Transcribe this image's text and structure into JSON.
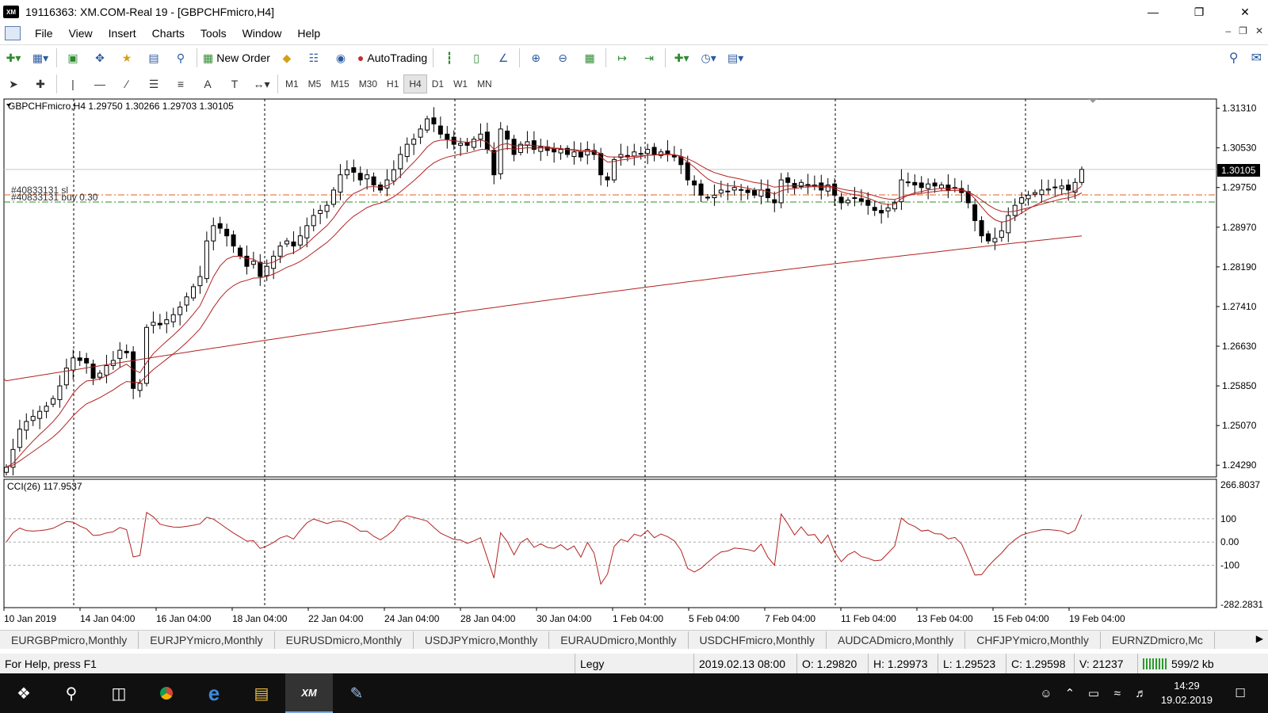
{
  "window": {
    "title": "19116363: XM.COM-Real 19 - [GBPCHFmicro,H4]",
    "logo": "XM"
  },
  "menu": [
    "File",
    "View",
    "Insert",
    "Charts",
    "Tools",
    "Window",
    "Help"
  ],
  "toolbar": {
    "new_order": "New Order",
    "auto_trading": "AutoTrading"
  },
  "timeframes": [
    "M1",
    "M5",
    "M15",
    "M30",
    "H1",
    "H4",
    "D1",
    "W1",
    "MN"
  ],
  "active_timeframe": "H4",
  "chart": {
    "header": "GBPCHFmicro,H4  1.29750 1.30266 1.29703 1.30105",
    "order_sl_label": "#40833131 sl",
    "order_buy_label": "#40833131 buy 0.30",
    "current_price": "1.30105",
    "price_ticks": [
      "1.31310",
      "1.30530",
      "1.29750",
      "1.28970",
      "1.28190",
      "1.27410",
      "1.26630",
      "1.25850",
      "1.25070",
      "1.24290"
    ],
    "indicator_label": "CCI(26) 117.9537",
    "cci_ticks": [
      "266.8037",
      "100",
      "0.00",
      "-100",
      "-282.2831"
    ],
    "time_ticks": [
      "10 Jan 2019",
      "14 Jan 04:00",
      "16 Jan 04:00",
      "18 Jan 04:00",
      "22 Jan 04:00",
      "24 Jan 04:00",
      "28 Jan 04:00",
      "30 Jan 04:00",
      "1 Feb 04:00",
      "5 Feb 04:00",
      "7 Feb 04:00",
      "11 Feb 04:00",
      "13 Feb 04:00",
      "15 Feb 04:00",
      "19 Feb 04:00"
    ],
    "colors": {
      "ma": "#b22222",
      "cci": "#b22222",
      "sl_line": "#e06020",
      "buy_line": "#2e8b2e",
      "candle": "#000000"
    }
  },
  "chart_data": {
    "type": "candlestick",
    "symbol": "GBPCHFmicro",
    "timeframe": "H4",
    "ohlc_last": {
      "open": 1.2975,
      "high": 1.30266,
      "low": 1.29703,
      "close": 1.30105
    },
    "ylim": [
      1.2406,
      1.3149
    ],
    "close_approx": [
      1.2425,
      1.246,
      1.25,
      1.2515,
      1.2525,
      1.2535,
      1.2545,
      1.256,
      1.2585,
      1.262,
      1.264,
      1.2635,
      1.263,
      1.26,
      1.261,
      1.2625,
      1.2635,
      1.2655,
      1.265,
      1.258,
      1.259,
      1.27,
      1.271,
      1.2705,
      1.2715,
      1.2725,
      1.274,
      1.276,
      1.278,
      1.28,
      1.287,
      1.29,
      1.2895,
      1.288,
      1.286,
      1.284,
      1.282,
      1.283,
      1.28,
      1.282,
      1.284,
      1.286,
      1.287,
      1.286,
      1.288,
      1.29,
      1.292,
      1.293,
      1.294,
      1.297,
      1.3,
      1.301,
      1.3005,
      1.299,
      1.3,
      1.298,
      1.297,
      1.299,
      1.301,
      1.304,
      1.306,
      1.307,
      1.309,
      1.311,
      1.31,
      1.308,
      1.307,
      1.306,
      1.3062,
      1.3058,
      1.307,
      1.308,
      1.305,
      1.3,
      1.309,
      1.307,
      1.304,
      1.306,
      1.3065,
      1.305,
      1.3055,
      1.3048,
      1.3045,
      1.305,
      1.304,
      1.3045,
      1.3035,
      1.305,
      1.304,
      1.3,
      1.299,
      1.303,
      1.304,
      1.3035,
      1.3045,
      1.3042,
      1.305,
      1.304,
      1.3045,
      1.3042,
      1.3035,
      1.302,
      1.299,
      1.298,
      1.296,
      1.2955,
      1.296,
      1.297,
      1.2968,
      1.2975,
      1.297,
      1.2965,
      1.296,
      1.297,
      1.2955,
      1.2945,
      1.299,
      1.2985,
      1.2975,
      1.2985,
      1.2978,
      1.298,
      1.297,
      1.298,
      1.296,
      1.2945,
      1.295,
      1.2955,
      1.2948,
      1.294,
      1.293,
      1.2925,
      1.2935,
      1.2945,
      1.299,
      1.2985,
      1.298,
      1.2975,
      1.2982,
      1.2978,
      1.298,
      1.297,
      1.2975,
      1.2965,
      1.2945,
      1.291,
      1.288,
      1.287,
      1.2875,
      1.289,
      1.292,
      1.294,
      1.2955,
      1.296,
      1.2965,
      1.297,
      1.2972,
      1.2975,
      1.2978,
      1.297,
      1.2985,
      1.30105
    ],
    "indicator": {
      "name": "CCI(26)",
      "last": 117.9537,
      "ylim": [
        -282.2831,
        266.8037
      ],
      "levels": [
        100,
        0,
        -100
      ]
    }
  },
  "symbol_tabs": [
    "EURGBPmicro,Monthly",
    "EURJPYmicro,Monthly",
    "EURUSDmicro,Monthly",
    "USDJPYmicro,Monthly",
    "EURAUDmicro,Monthly",
    "USDCHFmicro,Monthly",
    "AUDCADmicro,Monthly",
    "CHFJPYmicro,Monthly",
    "EURNZDmicro,Mc"
  ],
  "status": {
    "help": "For Help, press F1",
    "profile": "Legy",
    "datetime": "2019.02.13 08:00",
    "open": "O: 1.29820",
    "high": "H: 1.29973",
    "low": "L: 1.29523",
    "close": "C: 1.29598",
    "volume": "V: 21237",
    "traffic": "599/2 kb"
  },
  "taskbar": {
    "time": "14:29",
    "date": "19.02.2019",
    "xm_label": "XM"
  }
}
